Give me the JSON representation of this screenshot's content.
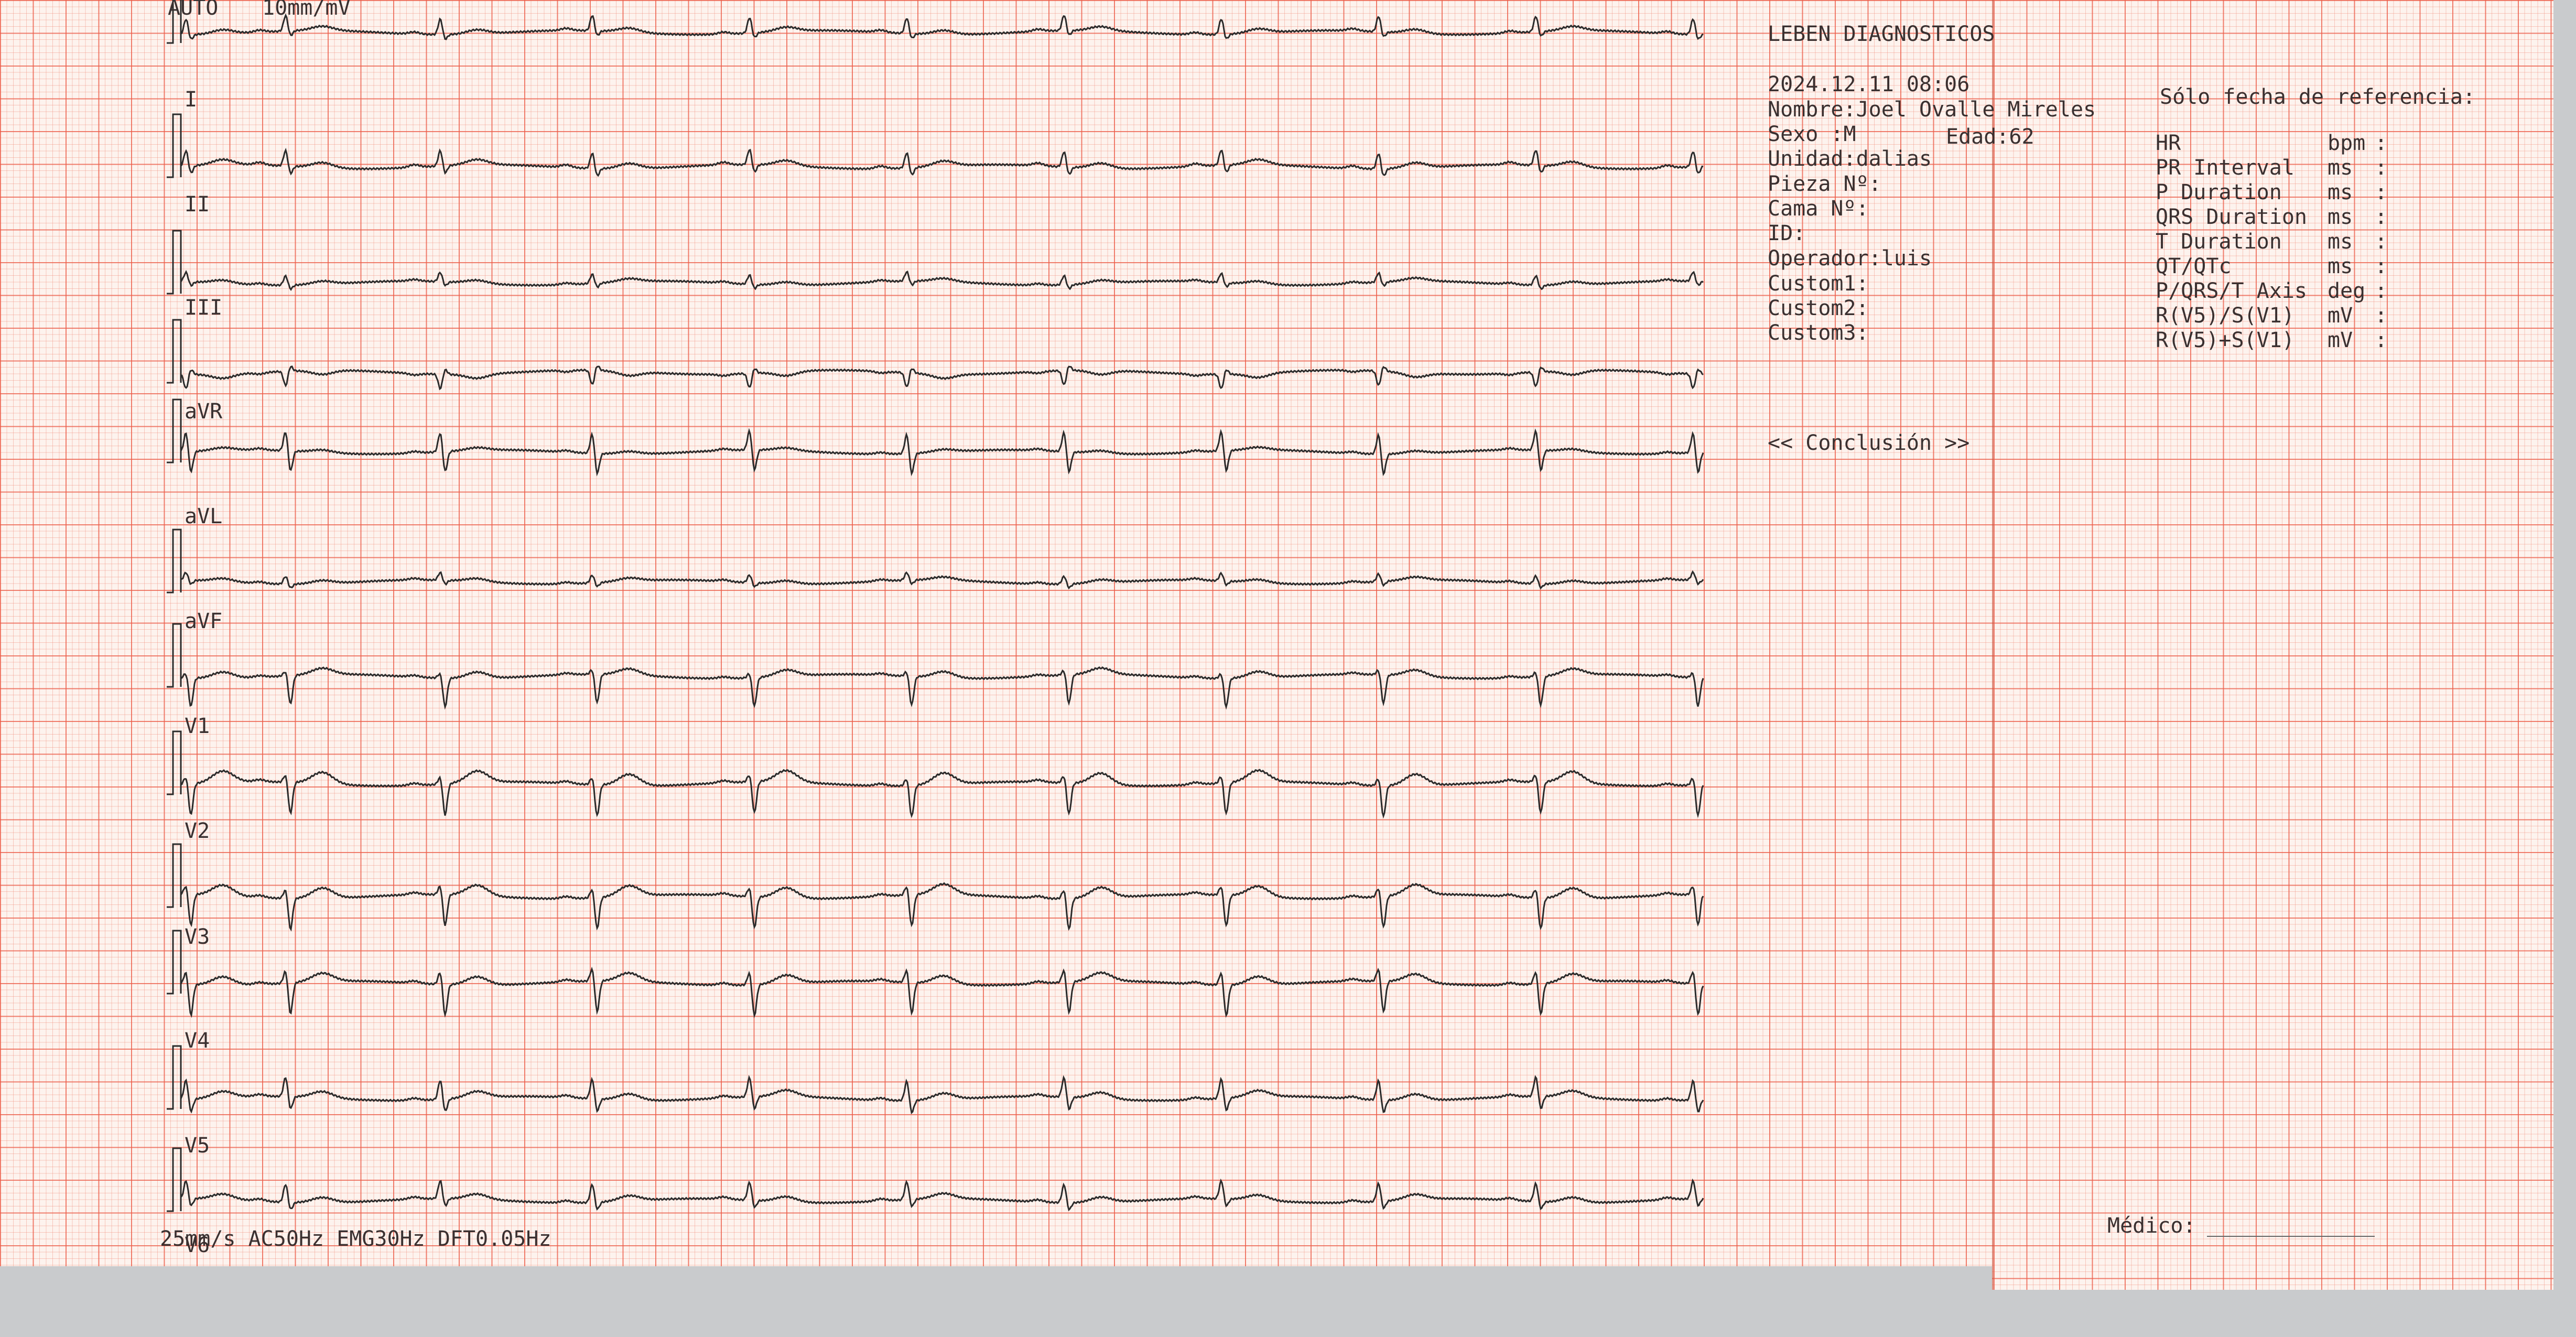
{
  "header": {
    "mode": "AUTO",
    "gain": "10mm/mV",
    "footer": "25mm/s  AC50Hz EMG30Hz DFT0.05Hz"
  },
  "leads": [
    "I",
    "II",
    "III",
    "aVR",
    "aVL",
    "aVF",
    "V1",
    "V2",
    "V3",
    "V4",
    "V5",
    "V6"
  ],
  "patient": {
    "institution": "LEBEN DIAGNOSTICOS",
    "datetime": "2024.12.11 08:06",
    "name": "Nombre:Joel Ovalle Mireles",
    "sex": "Sexo  :M",
    "age": "Edad:62",
    "unit": "Unidad:dalias",
    "room": "Pieza Nº:",
    "bed": "Cama Nº:",
    "id": "ID:",
    "operator": "Operador:luis",
    "custom1": "Custom1:",
    "custom2": "Custom2:",
    "custom3": "Custom3:",
    "conclusion": "<< Conclusión >>"
  },
  "measurements": {
    "title": "Sólo fecha de referencia:",
    "rows": [
      {
        "label": "HR",
        "unit": "bpm",
        "value": ":"
      },
      {
        "label": "PR Interval",
        "unit": "ms",
        "value": ":"
      },
      {
        "label": "P Duration",
        "unit": "ms",
        "value": ":"
      },
      {
        "label": "QRS Duration",
        "unit": "ms",
        "value": ":"
      },
      {
        "label": "T Duration",
        "unit": "ms",
        "value": ":"
      },
      {
        "label": "QT/QTc",
        "unit": "ms",
        "value": ":"
      },
      {
        "label": "P/QRS/T Axis",
        "unit": "deg",
        "value": ":"
      },
      {
        "label": "R(V5)/S(V1)",
        "unit": "mV",
        "value": ":"
      },
      {
        "label": "R(V5)+S(V1)",
        "unit": "mV",
        "value": ":"
      }
    ]
  },
  "doctor_label": "Médico:",
  "colors": {
    "trace": "#2b2b2b",
    "grid_major": "#ec5c48",
    "grid_minor": "#f08c78",
    "paper": "#fdf3ee"
  }
}
